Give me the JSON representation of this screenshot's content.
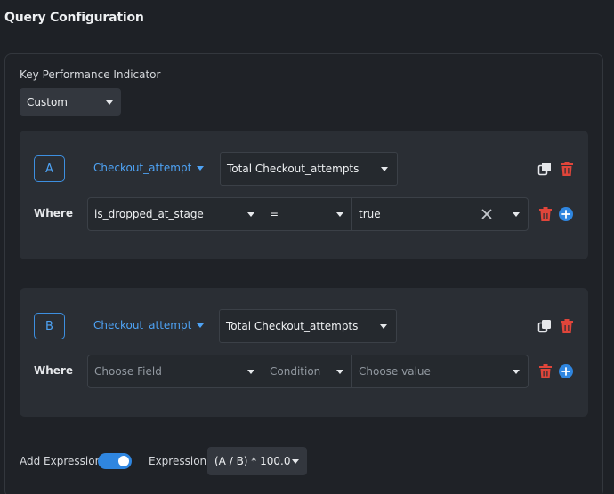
{
  "page": {
    "title": "Query Configuration"
  },
  "kpi": {
    "label": "Key Performance Indicator",
    "value": "Custom"
  },
  "queries": [
    {
      "letter": "A",
      "event": "Checkout_attempt",
      "metric": "Total Checkout_attempts",
      "where_label": "Where",
      "filter": {
        "field": "is_dropped_at_stage",
        "operator": "=",
        "value": "true"
      }
    },
    {
      "letter": "B",
      "event": "Checkout_attempt",
      "metric": "Total Checkout_attempts",
      "where_label": "Where",
      "filter": {
        "field_placeholder": "Choose Field",
        "operator_placeholder": "Condition",
        "value_placeholder": "Choose value"
      }
    }
  ],
  "footer": {
    "add_expression_label": "Add Expression",
    "add_expression_enabled": true,
    "expression_label": "Expression",
    "expression_value": "(A / B) * 100.0"
  },
  "colors": {
    "accent": "#4ea3f5",
    "toggle_on": "#2f86e0",
    "delete": "#e0453a",
    "background": "#1e2126",
    "card": "#2a2e34"
  },
  "icons": [
    "copy-icon",
    "trash-icon",
    "close-icon",
    "chevron-down-icon",
    "add-circle-icon"
  ]
}
